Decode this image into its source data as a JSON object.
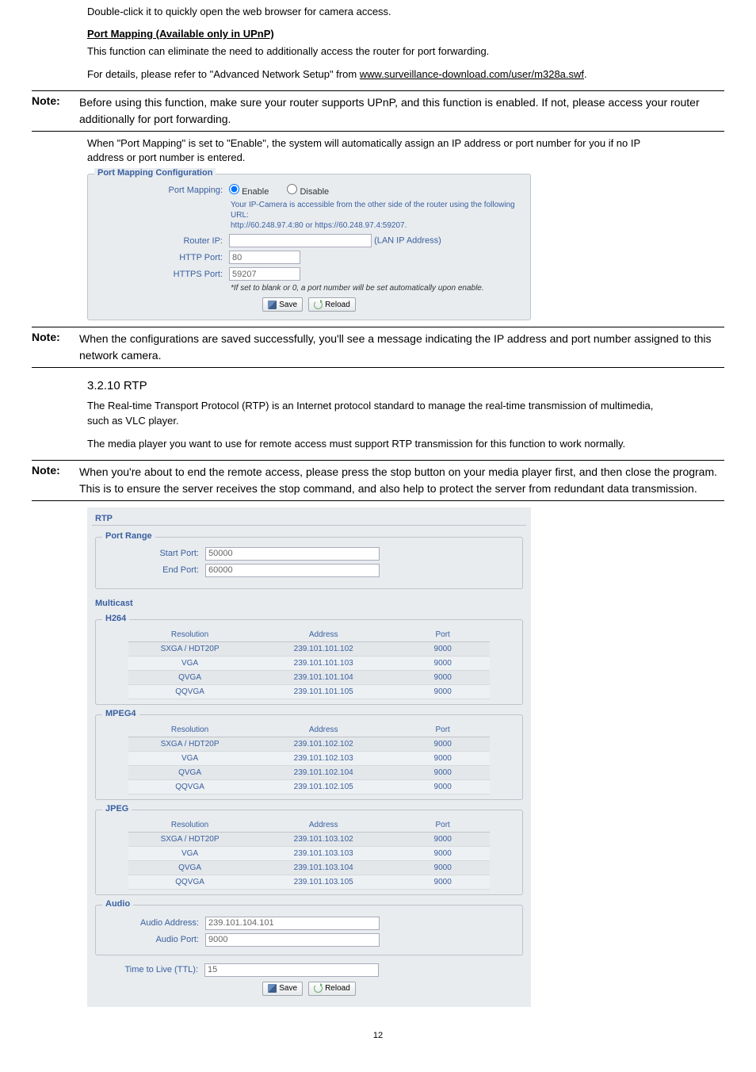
{
  "intro_para": "Double-click it to quickly open the web browser for camera access.",
  "pm_heading": "Port Mapping (Available only in UPnP)",
  "pm_para1": "This function can eliminate the need to additionally access the router for port forwarding.",
  "pm_para2_pre": "For details, please refer to \"Advanced Network Setup\" from ",
  "pm_para2_link": "www.surveillance-download.com/user/m328a.swf",
  "pm_para2_post": ".",
  "note_label": "Note:",
  "note1_body": "Before using this function, make sure your router supports UPnP, and this function is enabled. If not, please access your router additionally for port forwarding.",
  "pm_para3": "When \"Port Mapping\" is set to \"Enable\", the system will automatically assign an IP address or port number for you if no IP address or port number is entered.",
  "portmap": {
    "legend": "Port Mapping Configuration",
    "lbl_port_mapping": "Port Mapping:",
    "opt_enable": "Enable",
    "opt_disable": "Disable",
    "accessible_line1": "Your IP-Camera is accessible from the other side of the router using the following URL:",
    "accessible_line2": "http://60.248.97.4:80 or https://60.248.97.4:59207.",
    "lbl_router_ip": "Router IP:",
    "router_ip_hint": "(LAN IP Address)",
    "lbl_http": "HTTP Port:",
    "val_http": "80",
    "lbl_https": "HTTPS Port:",
    "val_https": "59207",
    "note_italic": "*If set to blank or 0, a port number will be set automatically upon enable.",
    "btn_save": "Save",
    "btn_reload": "Reload"
  },
  "note2_body": "When the configurations are saved successfully, you'll see a message indicating the IP address and port number assigned to this network camera.",
  "rtp_heading": "3.2.10 RTP",
  "rtp_para1": "The Real-time Transport Protocol (RTP) is an Internet protocol standard to manage the real-time transmission of multimedia, such as VLC player.",
  "rtp_para2": "The media player you want to use for remote access must support RTP transmission for this function to work normally.",
  "note3_body": "When you're about to end the remote access, please press the stop button on your media player first, and then close the program. This is to ensure the server receives the stop command, and also help to protect the server from redundant data transmission.",
  "rtp": {
    "title": "RTP",
    "portrange_legend": "Port Range",
    "lbl_start": "Start Port:",
    "val_start": "50000",
    "lbl_end": "End Port:",
    "val_end": "60000",
    "multicast_title": "Multicast",
    "cols": {
      "res": "Resolution",
      "addr": "Address",
      "port": "Port"
    },
    "h264": {
      "legend": "H264",
      "rows": [
        {
          "res": "SXGA / HDT20P",
          "addr": "239.101.101.102",
          "port": "9000"
        },
        {
          "res": "VGA",
          "addr": "239.101.101.103",
          "port": "9000"
        },
        {
          "res": "QVGA",
          "addr": "239.101.101.104",
          "port": "9000"
        },
        {
          "res": "QQVGA",
          "addr": "239.101.101.105",
          "port": "9000"
        }
      ]
    },
    "mpeg4": {
      "legend": "MPEG4",
      "rows": [
        {
          "res": "SXGA / HDT20P",
          "addr": "239.101.102.102",
          "port": "9000"
        },
        {
          "res": "VGA",
          "addr": "239.101.102.103",
          "port": "9000"
        },
        {
          "res": "QVGA",
          "addr": "239.101.102.104",
          "port": "9000"
        },
        {
          "res": "QQVGA",
          "addr": "239.101.102.105",
          "port": "9000"
        }
      ]
    },
    "jpeg": {
      "legend": "JPEG",
      "rows": [
        {
          "res": "SXGA / HDT20P",
          "addr": "239.101.103.102",
          "port": "9000"
        },
        {
          "res": "VGA",
          "addr": "239.101.103.103",
          "port": "9000"
        },
        {
          "res": "QVGA",
          "addr": "239.101.103.104",
          "port": "9000"
        },
        {
          "res": "QQVGA",
          "addr": "239.101.103.105",
          "port": "9000"
        }
      ]
    },
    "audio_legend": "Audio",
    "lbl_audio_addr": "Audio Address:",
    "val_audio_addr": "239.101.104.101",
    "lbl_audio_port": "Audio Port:",
    "val_audio_port": "9000",
    "lbl_ttl": "Time to Live (TTL):",
    "val_ttl": "15",
    "btn_save": "Save",
    "btn_reload": "Reload"
  },
  "page_number": "12"
}
